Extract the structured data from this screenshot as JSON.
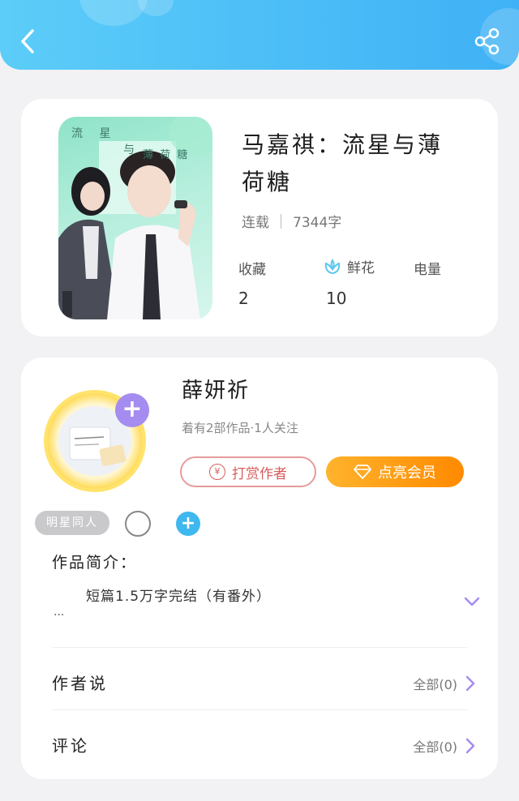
{
  "colors": {
    "header_start": "#5ccdf8",
    "header_end": "#3fb1f6",
    "vip_gradient": [
      "#ffb32c",
      "#ff8a00"
    ],
    "follow_accent": "#a58cf0",
    "tip_accent": "#d85c5c",
    "flower_icon": "#5ac7ee"
  },
  "header": {
    "back_icon": "chevron-left-icon",
    "share_icon": "share-icon"
  },
  "book": {
    "cover_text_top": "流 星",
    "cover_text_mid": "与",
    "cover_text_right": "薄 荷 糖",
    "title": "马嘉祺：流星与薄荷糖",
    "status": "连载",
    "word_count": "7344字",
    "stats": {
      "favorites_label": "收藏",
      "favorites_value": "2",
      "flowers_label": "鲜花",
      "flowers_value": "10",
      "power_label": "电量"
    }
  },
  "author": {
    "name": "薛妍祈",
    "summary": "着有2部作品·1人关注",
    "tip_button": "打赏作者",
    "vip_button": "点亮会员"
  },
  "tags": {
    "category": "明星同人"
  },
  "intro": {
    "title": "作品简介：",
    "text": "短篇1.5万字完结（有番外）",
    "ellipsis": "..."
  },
  "sections": {
    "author_says": {
      "label": "作者说",
      "right": "全部(0)"
    },
    "comments": {
      "label": "评论",
      "right": "全部(0)"
    }
  }
}
